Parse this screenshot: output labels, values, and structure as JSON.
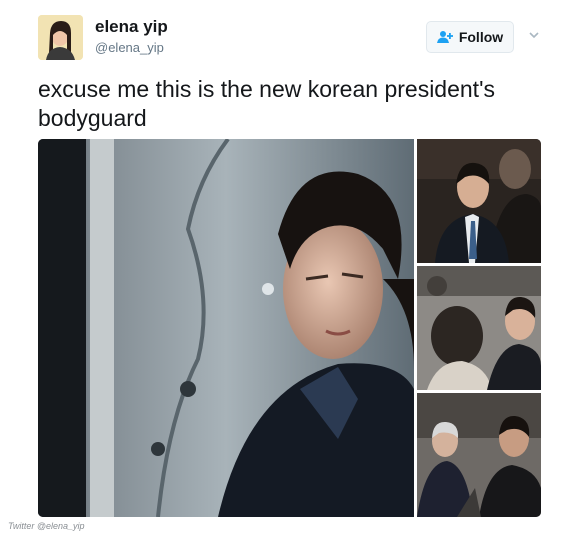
{
  "tweet": {
    "display_name": "elena yip",
    "handle": "@elena_yip",
    "text": "excuse me this is the new korean president's bodyguard",
    "follow_label": "Follow"
  },
  "icons": {
    "follow": "person-add-icon",
    "menu": "chevron-down-icon"
  },
  "colors": {
    "accent": "#1da1f2",
    "name": "#14171a",
    "secondary": "#657786"
  },
  "media": {
    "photo_count": 4
  },
  "footer": {
    "watermark": "Twitter @elena_yip"
  }
}
